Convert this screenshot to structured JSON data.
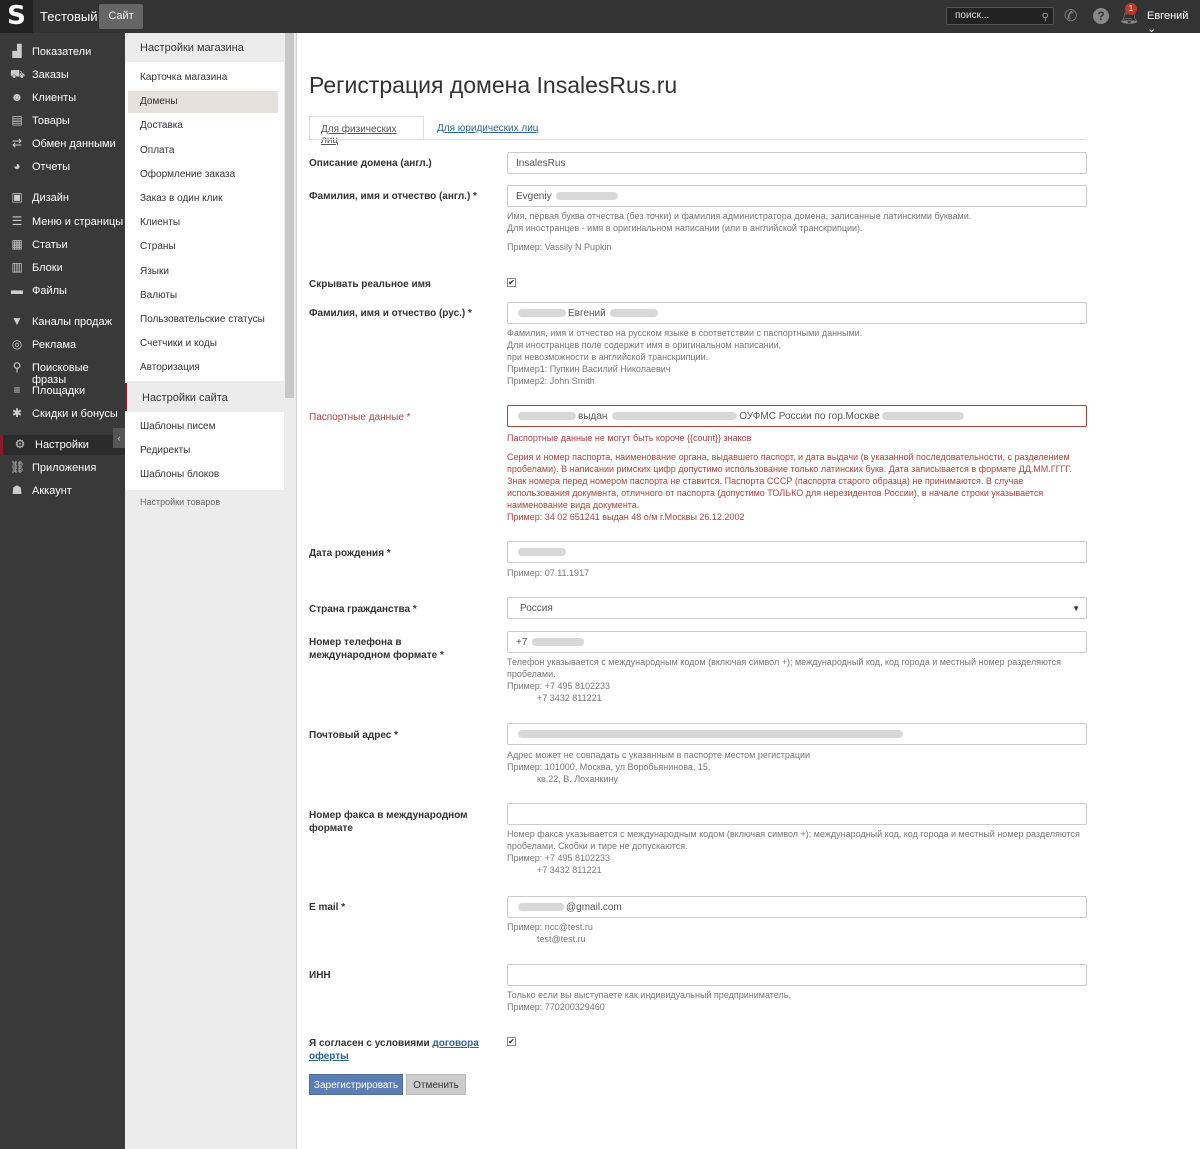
{
  "topbar": {
    "logo": "S",
    "shop_name": "Тестовый",
    "site_button": "Сайт",
    "search_placeholder": "поиск...",
    "notifications_count": "1",
    "user_name": "Евгений"
  },
  "nav": {
    "items": [
      {
        "label": "Показатели",
        "icon": "chart-icon",
        "glyph": "▟"
      },
      {
        "label": "Заказы",
        "icon": "cart-icon",
        "glyph": "⛟"
      },
      {
        "label": "Клиенты",
        "icon": "users-icon",
        "glyph": "☻"
      },
      {
        "label": "Товары",
        "icon": "book-icon",
        "glyph": "▤"
      },
      {
        "label": "Обмен данными",
        "icon": "exchange-icon",
        "glyph": "⇄"
      },
      {
        "label": "Отчеты",
        "icon": "pie-chart-icon",
        "glyph": "◕"
      },
      {
        "label": "Дизайн",
        "icon": "picture-icon",
        "glyph": "▣"
      },
      {
        "label": "Меню и страницы",
        "icon": "menu-pages-icon",
        "glyph": "☰"
      },
      {
        "label": "Статьи",
        "icon": "articles-icon",
        "glyph": "▦"
      },
      {
        "label": "Блоки",
        "icon": "blocks-icon",
        "glyph": "▥"
      },
      {
        "label": "Файлы",
        "icon": "folder-icon",
        "glyph": "▬"
      },
      {
        "label": "Каналы продаж",
        "icon": "funnel-icon",
        "glyph": "▼"
      },
      {
        "label": "Реклама",
        "icon": "target-icon",
        "glyph": "◎"
      },
      {
        "label": "Поисковые фразы",
        "icon": "search-icon",
        "glyph": "⚲"
      },
      {
        "label": "Площадки",
        "icon": "list-icon",
        "glyph": "≡"
      },
      {
        "label": "Скидки и бонусы",
        "icon": "gift-icon",
        "glyph": "✱"
      },
      {
        "label": "Настройки",
        "icon": "gear-icon",
        "glyph": "⚙"
      },
      {
        "label": "Приложения",
        "icon": "link-icon",
        "glyph": "⛓"
      },
      {
        "label": "Аккаунт",
        "icon": "user-icon",
        "glyph": "☗"
      }
    ],
    "active_label": "Настройки",
    "collapse_glyph": "‹"
  },
  "subnav": {
    "store_settings_header": "Настройки магазина",
    "store_items": [
      "Карточка магазина",
      "Домены",
      "Доставка",
      "Оплата",
      "Оформление заказа",
      "Заказ в один клик",
      "Клиенты",
      "Страны",
      "Языки",
      "Валюты",
      "Пользовательские статусы",
      "Счетчики и коды",
      "Авторизация"
    ],
    "active_item": "Домены",
    "site_settings_header": "Настройки сайта",
    "site_items": [
      "Шаблоны писем",
      "Редиректы",
      "Шаблоны блоков"
    ],
    "cut_header": "Настройки товаров"
  },
  "page": {
    "title": "Регистрация домена InsalesRus.ru",
    "tabs": [
      "Для физических лиц",
      "Для юридических лиц"
    ],
    "active_tab": "Для физических лиц"
  },
  "form": {
    "domain_description": {
      "label": "Описание домена (англ.)",
      "value": "InsalesRus"
    },
    "full_name_en": {
      "label": "Фамилия, имя и отчество (англ.) *",
      "value_visible": "Evgeniy",
      "help": [
        "Имя, первая буква отчества (без точки) и фамилия администратора домена, записанные латинскими буквами.",
        "Для иностранцев - имя в оригинальном написании (или в английской транскрипции)."
      ],
      "example": "Пример: Vassily N Pupkin"
    },
    "hide_real_name": {
      "label": "Скрывать реальное имя",
      "checked": true
    },
    "full_name_ru": {
      "label": "Фамилия, имя и отчество (рус.) *",
      "value_visible": "Евгений",
      "help": [
        "Фамилия, имя и отчество на русском языке в соответствии с паспортными данными.",
        "Для иностранцев поле содержит имя в оригинальном написании,",
        "при невозможности в английской транскрипции.",
        "Пример1: Пупкин Василий Николаевич",
        "Пример2: John Smith"
      ]
    },
    "passport": {
      "label": "Паспортные данные *",
      "value_visible_1": "выдан",
      "value_visible_2": "ОУФМС России по гор.Москве",
      "error": "Паспортные данные не могут быть короче {{count}} знаков",
      "help": "Серия и номер паспорта, наименование органа, выдавшего паспорт, и дата выдачи (в указанной последовательности, с разделением пробелами). В написании римских цифр допустимо использование только латинских букв. Дата записывается в формате ДД.ММ.ГГГГ. Знак номера перед номером паспорта не ставится. Паспорта СССР (паспорта старого образца) не принимаются. В случае использования документа, отличного от паспорта (допустимо ТОЛЬКО для нерезидентов России), в начале строки указывается наименование вида документа.",
      "example": "Пример: 34 02 651241 выдан 48 о/м г.Москвы 26.12.2002"
    },
    "birth_date": {
      "label": "Дата рождения *",
      "example": "Пример: 07.11.1917"
    },
    "citizenship": {
      "label": "Страна гражданства *",
      "value": "Россия"
    },
    "phone": {
      "label": "Номер телефона в международном формате *",
      "value_visible": "+7",
      "help": [
        "Телефон указывается с международным кодом (включая символ +); международный код, код города и местный номер разделяются",
        "пробелами.",
        "Пример: +7 495 8102233",
        "            +7 3432 811221"
      ]
    },
    "postal_address": {
      "label": "Почтовый адрес *",
      "help": [
        "Адрес может не совпадать с указанным в паспорте местом регистрации",
        "Пример: 101000, Москва, ул Воробьянинова, 15,",
        "            кв.22, В. Лоханкину"
      ]
    },
    "fax": {
      "label": "Номер факса в международном формате",
      "help": [
        "Номер факса указывается с международным кодом (включая символ +); международный код, код города и местный номер разделяются",
        "пробелами. Скобки и тире не допускаются.",
        "Пример: +7 495 8102233",
        "            +7 3432 811221"
      ]
    },
    "email": {
      "label": "E mail *",
      "value_visible": "@gmail.com",
      "help": [
        "Пример: ncc@test.ru",
        "            test@test.ru"
      ]
    },
    "inn": {
      "label": "ИНН",
      "help": [
        "Только если вы выступаете как индивидуальный предприниматель.",
        "Пример: 770200329460"
      ]
    },
    "agreement": {
      "label": "Я согласен с условиями",
      "link": "договора оферты",
      "checked": true
    },
    "register_button": "Зарегистрировать",
    "cancel_button": "Отменить"
  },
  "colors": {
    "topbar": "#333333",
    "sidebar": "#393939",
    "accent_active": "#8b1a2b",
    "primary_button": "#5b7fb5",
    "error": "#a94442"
  }
}
